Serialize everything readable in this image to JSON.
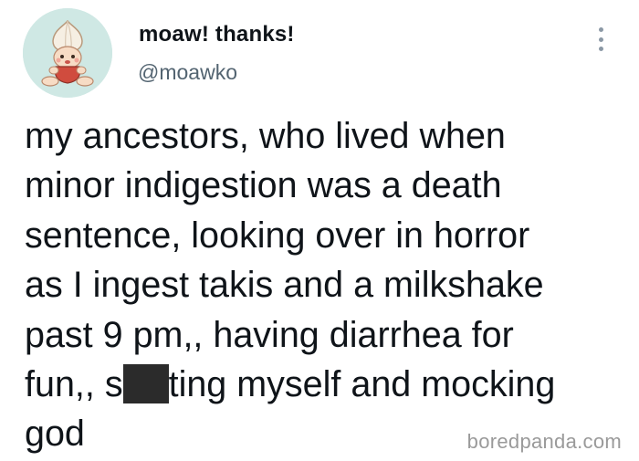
{
  "author": {
    "display_name": "moaw! thanks!",
    "handle": "@moawko",
    "avatar": "onion-character-avatar"
  },
  "more_menu_icon": "vertical-dots-icon",
  "tweet": {
    "lines": [
      "my ancestors, who lived when",
      "minor indigestion was a death",
      "sentence, looking over in horror",
      "as I ingest takis and a milkshake",
      "past 9 pm,, having diarrhea for",
      "fun,, s",
      "ting myself and mocking",
      "god"
    ]
  },
  "watermark": "boredpanda.com",
  "colors": {
    "text": "#0f1419",
    "handle": "#536471",
    "avatar_bg": "#cfe8e4",
    "censor_bar": "#2b2b2b",
    "watermark": "#9a9a9a"
  }
}
